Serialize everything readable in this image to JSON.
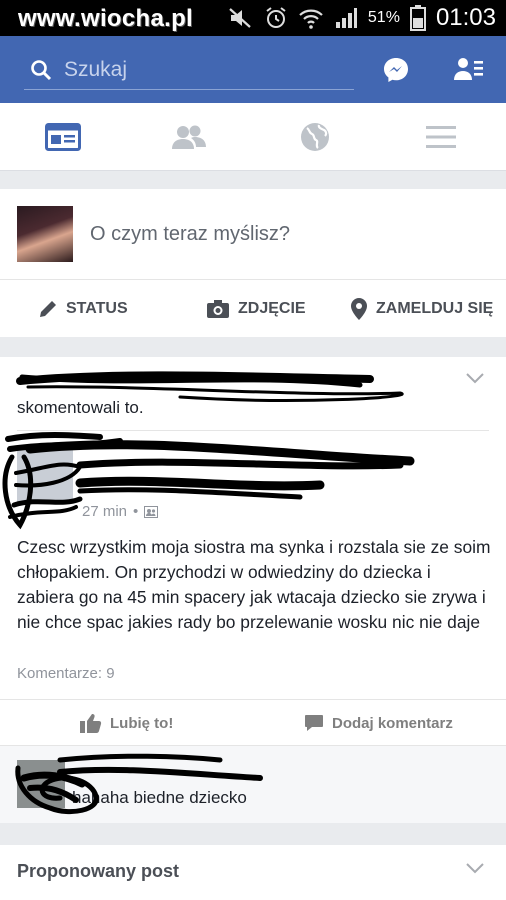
{
  "status_bar": {
    "watermark": "www.wiocha.pl",
    "battery_percent": "51%",
    "time": "01:03",
    "icons": [
      "mute-icon",
      "alarm-icon",
      "wifi-icon",
      "signal-icon",
      "battery-icon"
    ]
  },
  "header": {
    "search_placeholder": "Szukaj",
    "icons": [
      "search-icon",
      "messenger-icon",
      "friend-requests-icon"
    ],
    "brand_color": "#4267b2"
  },
  "tabs": [
    {
      "name": "news-feed",
      "icon": "news-feed-icon",
      "active": true
    },
    {
      "name": "friends",
      "icon": "friends-icon",
      "active": false
    },
    {
      "name": "notifications",
      "icon": "globe-icon",
      "active": false
    },
    {
      "name": "menu",
      "icon": "menu-icon",
      "active": false
    }
  ],
  "composer": {
    "prompt": "O czym teraz myślisz?",
    "actions": [
      {
        "label": "STATUS",
        "icon": "pencil-icon"
      },
      {
        "label": "ZDJĘCIE",
        "icon": "camera-icon"
      },
      {
        "label": "ZAMELDUJ SIĘ",
        "icon": "location-pin-icon"
      }
    ]
  },
  "post": {
    "context_line": "skomentowali to.",
    "time": "27 min",
    "body": "Czesc wrzystkim moja siostra ma synka i rozstala sie ze soim chłopakiem. On przychodzi w odwiedziny do dziecka i zabiera go na  45 min spacery jak wtacaja dziecko sie zrywa i nie chce spac jakies rady bo przelewanie wosku nic nie daje",
    "comment_count": "Komentarze: 9",
    "actions": [
      {
        "label": "Lubię to!",
        "icon": "thumbs-up-icon"
      },
      {
        "label": "Dodaj komentarz",
        "icon": "comment-icon"
      }
    ]
  },
  "comment_preview": {
    "text": "hahaha biedne dziecko"
  },
  "suggested": {
    "title": "Proponowany post"
  }
}
